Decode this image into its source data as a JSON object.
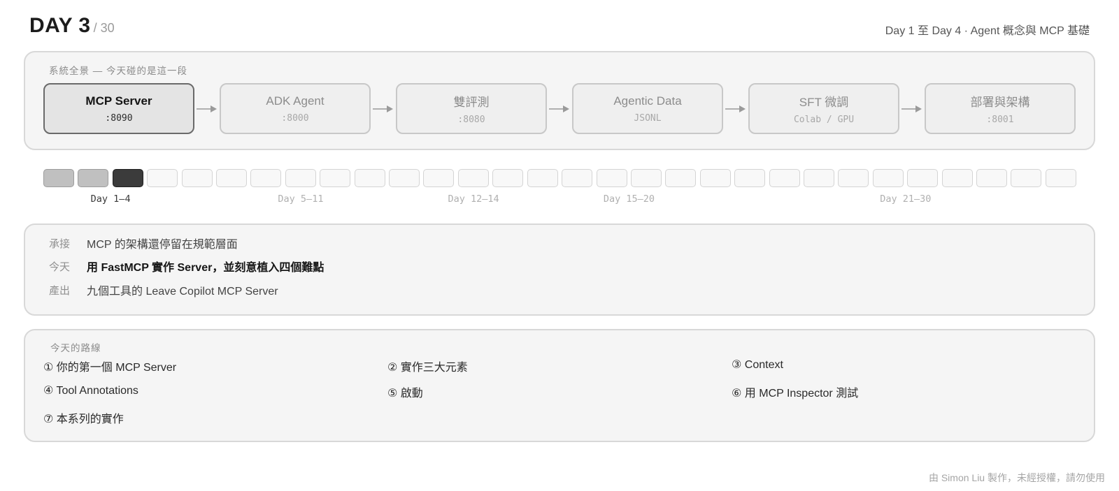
{
  "header": {
    "day_label": "DAY 3",
    "total_label": "/ 30",
    "subtitle": "Day 1 至 Day 4 · Agent 概念與 MCP 基礎"
  },
  "architecture": {
    "label": "系統全景 — 今天碰的是這一段",
    "nodes": [
      {
        "name": "MCP Server",
        "port": ":8090",
        "active": true
      },
      {
        "name": "ADK Agent",
        "port": ":8000",
        "active": false
      },
      {
        "name": "雙評測",
        "port": ":8080",
        "active": false
      },
      {
        "name": "Agentic Data",
        "port": "JSONL",
        "active": false
      },
      {
        "name": "SFT 微調",
        "port": "Colab / GPU",
        "active": false
      },
      {
        "name": "部署與架構",
        "port": ":8001",
        "active": false
      }
    ]
  },
  "timeline": {
    "total_days": 30,
    "current_day": 3,
    "phases": [
      {
        "label": "Day 1–4",
        "start": 1,
        "end": 4
      },
      {
        "label": "Day 5–11",
        "start": 5,
        "end": 11
      },
      {
        "label": "Day 12–14",
        "start": 12,
        "end": 14
      },
      {
        "label": "Day 15–20",
        "start": 15,
        "end": 20
      },
      {
        "label": "Day 21–30",
        "start": 21,
        "end": 30
      }
    ]
  },
  "summary": {
    "rows": [
      {
        "key": "承接",
        "value": "MCP 的架構還停留在規範層面"
      },
      {
        "key": "今天",
        "value": "用 FastMCP 實作 Server，並刻意植入四個難點"
      },
      {
        "key": "產出",
        "value": "九個工具的 Leave Copilot MCP Server"
      }
    ]
  },
  "route": {
    "label": "今天的路線",
    "items": [
      "① 你的第一個 MCP Server",
      "② 實作三大元素",
      "③ Context",
      "④ Tool Annotations",
      "⑤ 啟動",
      "⑥ 用 MCP Inspector 測試",
      "⑦ 本系列的實作"
    ]
  },
  "footer": {
    "credit": "由 Simon Liu 製作，未經授權，請勿使用"
  }
}
